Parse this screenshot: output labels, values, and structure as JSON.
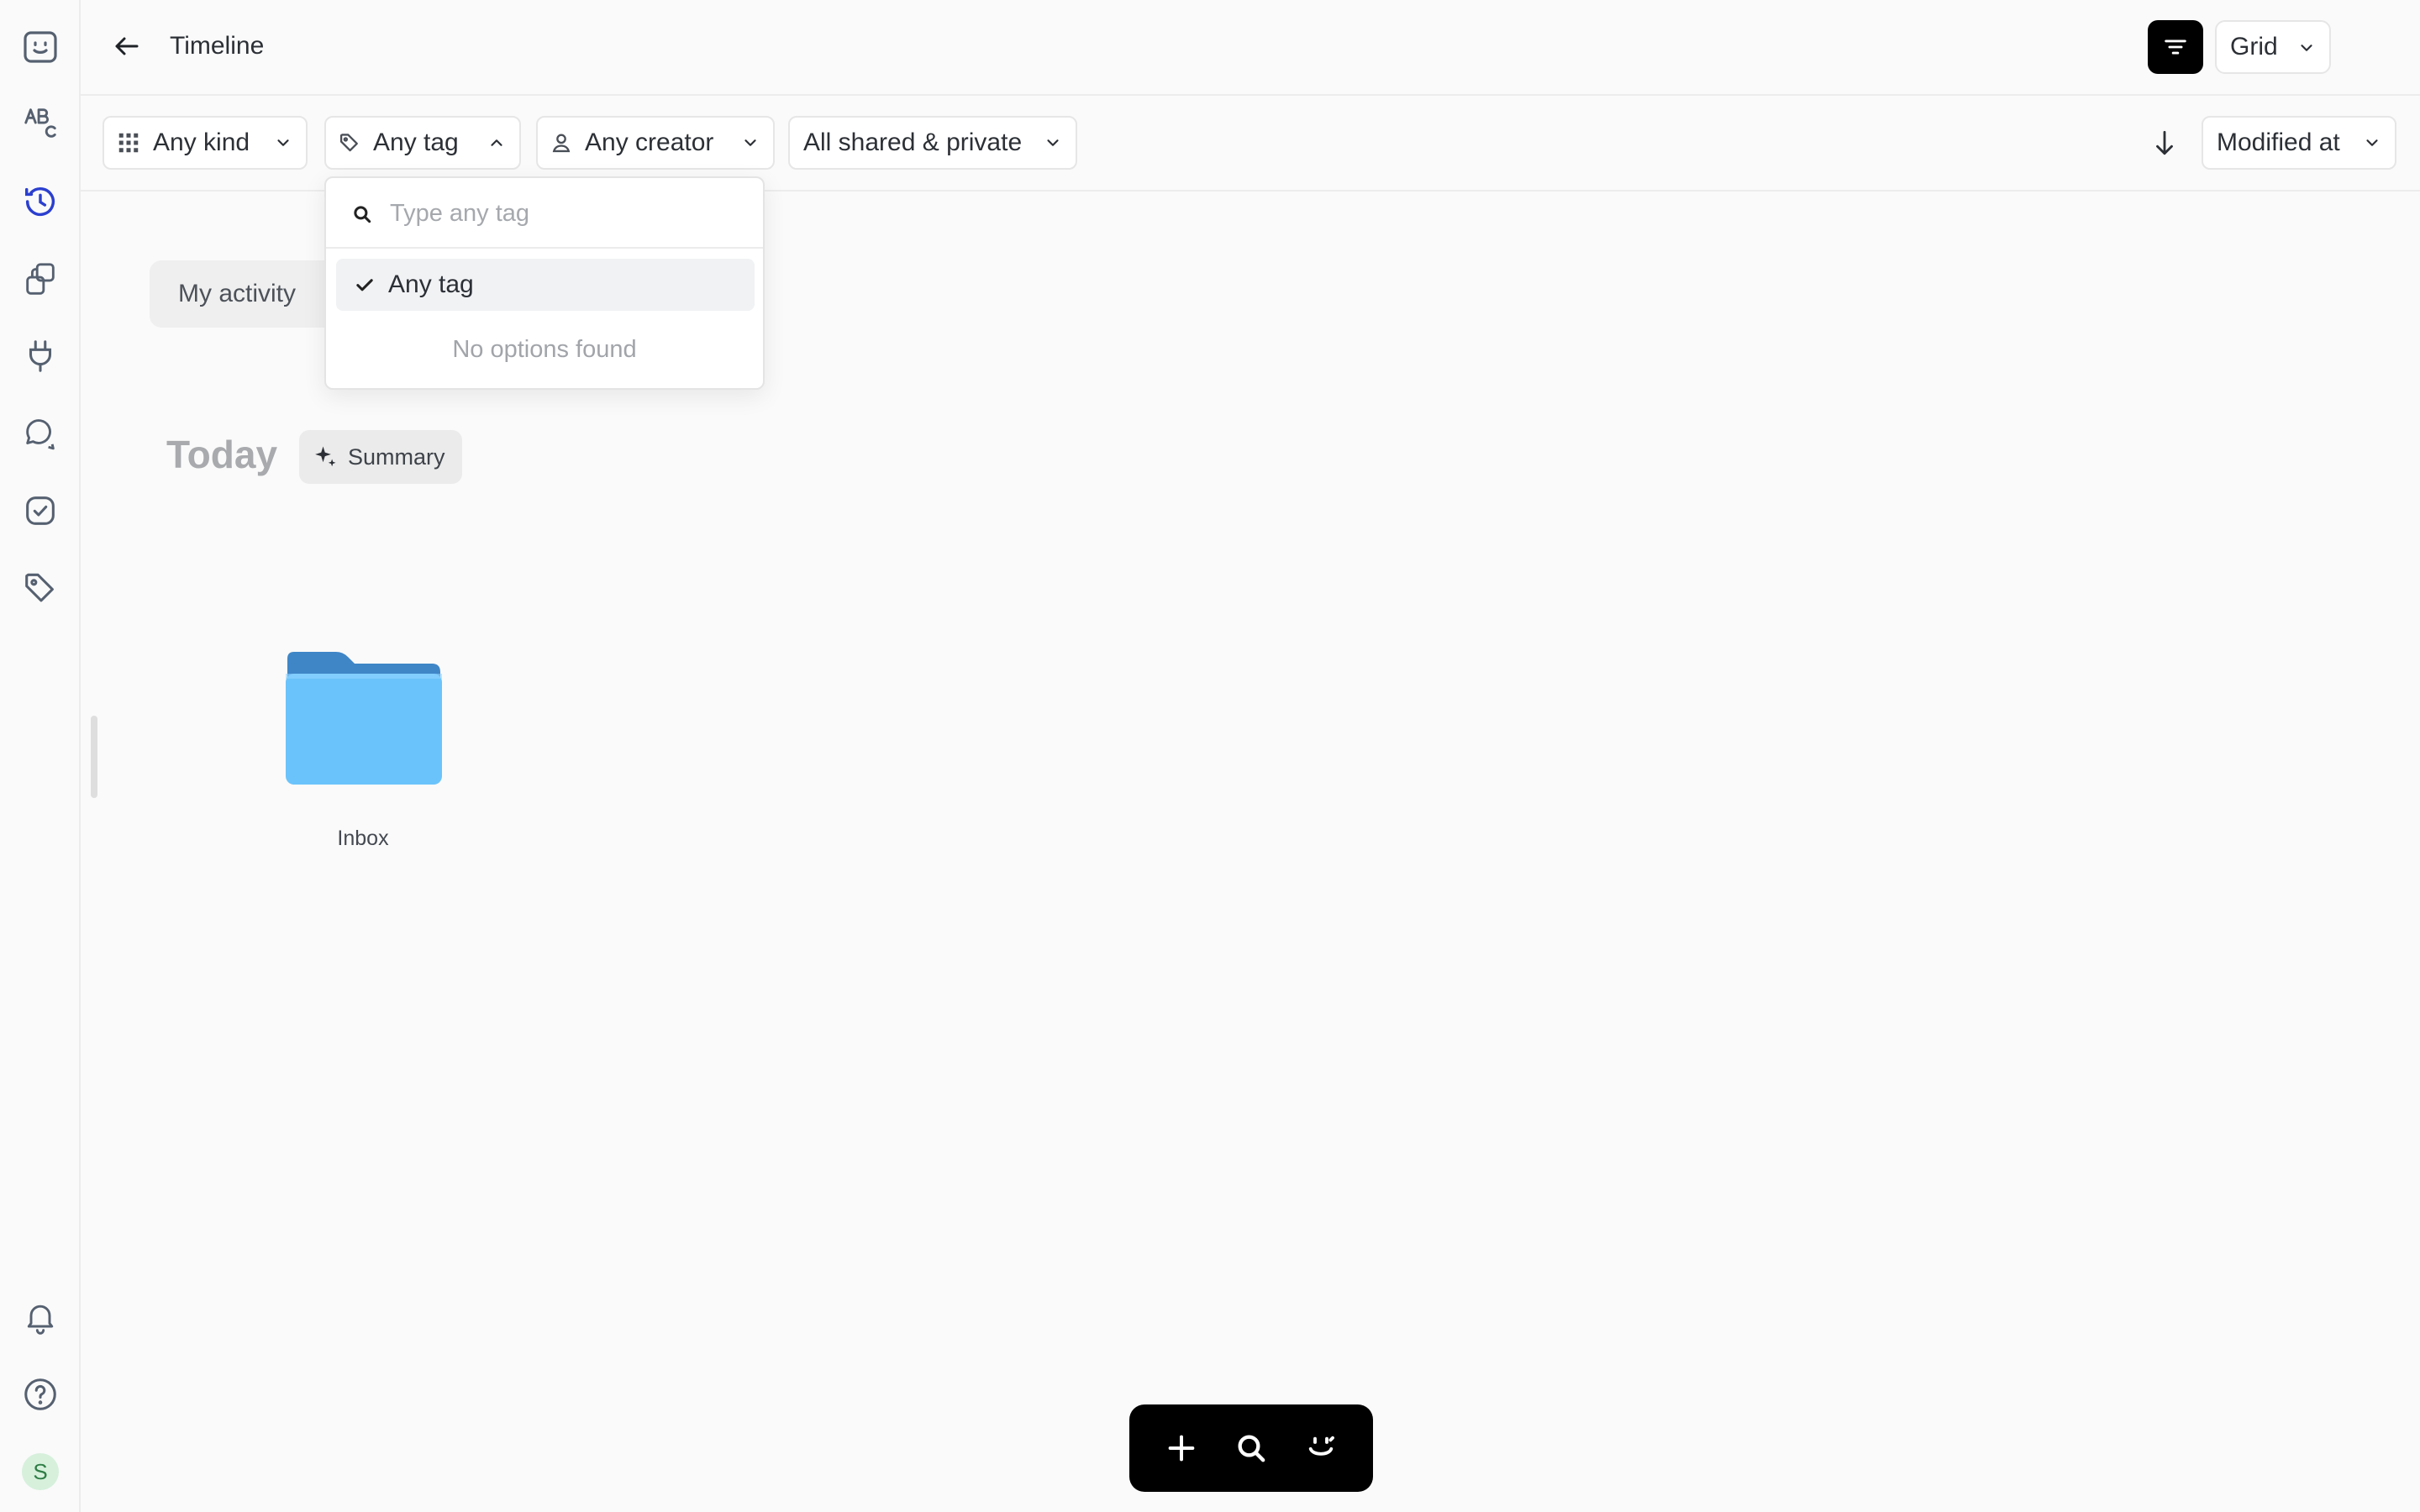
{
  "header": {
    "title": "Timeline",
    "view_mode": "Grid"
  },
  "filters": {
    "kind": "Any kind",
    "tag": "Any tag",
    "creator": "Any creator",
    "sharing": "All shared & private",
    "sort_field": "Modified at"
  },
  "tag_dropdown": {
    "search_placeholder": "Type any tag",
    "selected_option": "Any tag",
    "empty_message": "No options found"
  },
  "content": {
    "activity_tab": "My activity",
    "section_title": "Today",
    "summary_label": "Summary",
    "items": [
      {
        "name": "Inbox",
        "icon": "folder-icon"
      }
    ]
  },
  "sidebar": {
    "avatar_initial": "S",
    "icons": [
      "app-logo-icon",
      "text-abc-icon",
      "clock-icon",
      "collections-icon",
      "plug-icon",
      "chat-icon",
      "task-check-icon",
      "tag-icon",
      "bell-icon",
      "help-icon"
    ],
    "active": "clock-icon"
  },
  "colors": {
    "accent": "#2b3fcf",
    "folder_light": "#6bc3fb",
    "folder_dark": "#3f86c7"
  }
}
